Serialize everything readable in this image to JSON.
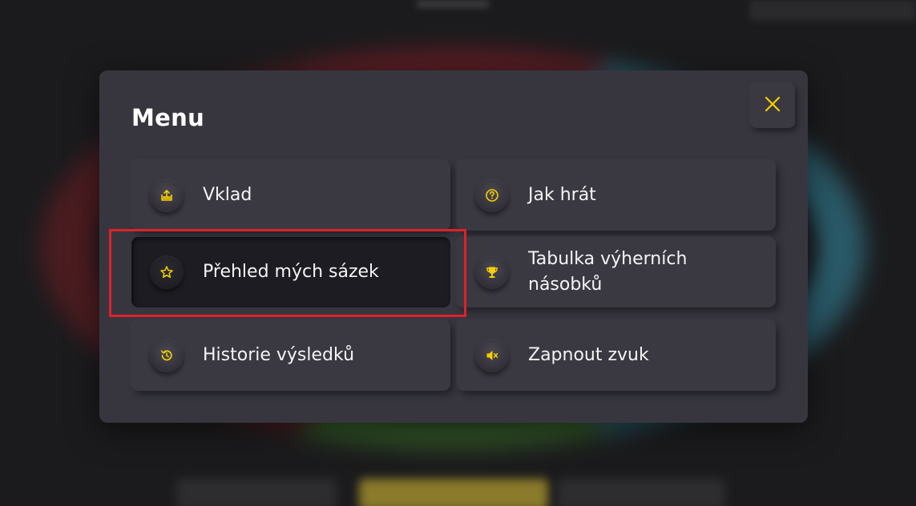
{
  "modal": {
    "title": "Menu",
    "close_icon": "close-icon"
  },
  "menu": {
    "items": [
      {
        "label": "Vklad",
        "icon": "deposit-icon"
      },
      {
        "label": "Jak hrát",
        "icon": "help-icon"
      },
      {
        "label": "Přehled mých sázek",
        "icon": "star-icon",
        "active": true
      },
      {
        "label": "Tabulka výherních násobků",
        "icon": "trophy-icon"
      },
      {
        "label": "Historie výsledků",
        "icon": "history-icon"
      },
      {
        "label": "Zapnout zvuk",
        "icon": "sound-muted-icon"
      }
    ]
  },
  "colors": {
    "accent": "#f5d000",
    "highlight": "#e0202a",
    "modal_bg": "#37363f"
  }
}
